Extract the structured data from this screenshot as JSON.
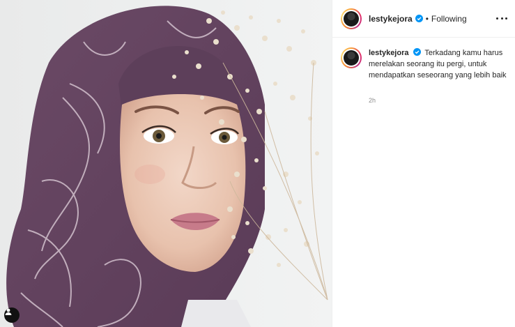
{
  "post": {
    "username": "lestykejora",
    "follow_status": "Following",
    "separator": "•",
    "caption": "Terkadang kamu harus merelakan seorang itu pergi, untuk mendapatkan seseorang yang lebih baik",
    "timestamp": "2h"
  },
  "icons": {
    "verified": "verified-badge-icon",
    "more": "more-options-icon",
    "user_tag": "tagged-user-icon"
  },
  "colors": {
    "verified_blue": "#0095f6",
    "border": "#efefef",
    "muted": "#8e8e8e"
  }
}
